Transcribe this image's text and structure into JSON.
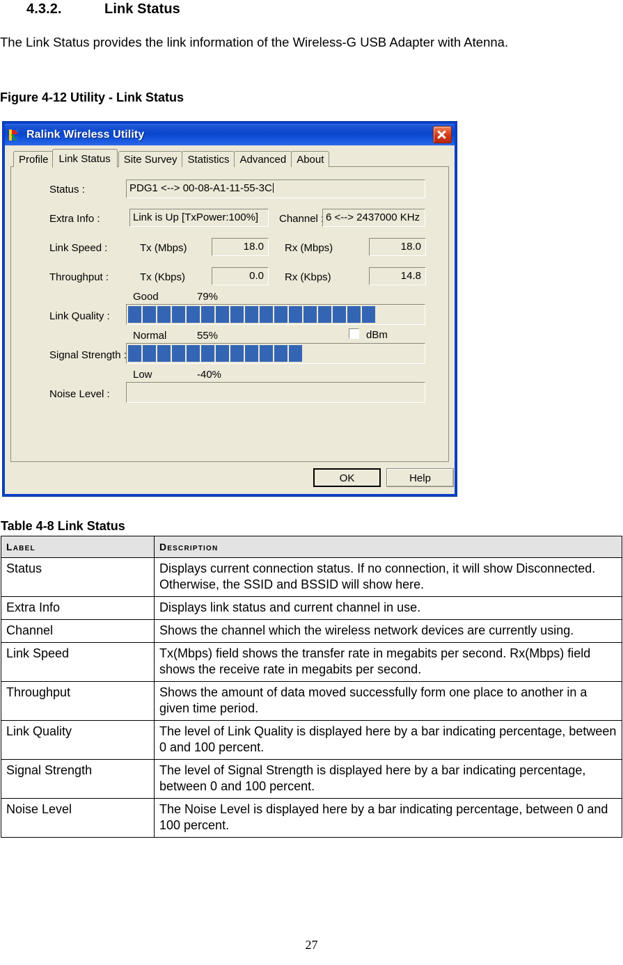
{
  "document": {
    "section_number": "4.3.2.",
    "section_title": "Link Status",
    "intro_paragraph": "The Link Status provides the link information of the Wireless-G USB Adapter with Atenna.",
    "figure_caption": "Figure 4-12 Utility - Link Status",
    "table_caption": "Table 4-8 Link Status",
    "page_number": "27"
  },
  "dialog": {
    "title": "Ralink Wireless Utility",
    "icon": "ralink-logo-icon",
    "close_label": "Close",
    "tabs": [
      {
        "label": "Profile",
        "selected": false
      },
      {
        "label": "Link Status",
        "selected": true
      },
      {
        "label": "Site Survey",
        "selected": false
      },
      {
        "label": "Statistics",
        "selected": false
      },
      {
        "label": "Advanced",
        "selected": false
      },
      {
        "label": "About",
        "selected": false
      }
    ],
    "fields": {
      "status_label": "Status :",
      "status_value": "PDG1 <--> 00-08-A1-11-55-3C",
      "extra_info_label": "Extra Info :",
      "extra_info_value": "Link is Up [TxPower:100%]",
      "channel_label": "Channel :",
      "channel_value": "6 <--> 2437000 KHz",
      "link_speed_label": "Link Speed :",
      "link_speed_tx_label": "Tx (Mbps)",
      "link_speed_tx_value": "18.0",
      "link_speed_rx_label": "Rx (Mbps)",
      "link_speed_rx_value": "18.0",
      "throughput_label": "Throughput :",
      "throughput_tx_label": "Tx (Kbps)",
      "throughput_tx_value": "0.0",
      "throughput_rx_label": "Rx (Kbps)",
      "throughput_rx_value": "14.8",
      "link_quality_label": "Link Quality :",
      "link_quality_rating": "Good",
      "link_quality_percent": "79%",
      "signal_strength_label": "Signal Strength :",
      "signal_strength_rating": "Normal",
      "signal_strength_percent": "55%",
      "noise_level_label": "Noise Level :",
      "noise_level_rating": "Low",
      "noise_level_percent": "-40%",
      "dbm_label": "dBm",
      "dbm_checked": false
    },
    "buttons": {
      "ok_label": "OK",
      "help_label": "Help"
    },
    "colors": {
      "titlebar_blue": "#0a45cd",
      "window_face": "#ece9d8",
      "meter_fill": "#3465b4",
      "close_red": "#cf3516"
    }
  },
  "meters": {
    "link_quality_segments": 17,
    "signal_strength_segments": 12,
    "noise_level_segments": 0,
    "segments_total": 21
  },
  "reference_table": {
    "headers": [
      "Label",
      "Description"
    ],
    "rows": [
      {
        "label": "Status",
        "description": "Displays current connection status. If no connection, it will show Disconnected. Otherwise, the SSID and BSSID will show here."
      },
      {
        "label": "Extra Info",
        "description": "Displays link status and current channel in use."
      },
      {
        "label": "Channel",
        "description": "Shows the channel which the wireless network devices are currently using."
      },
      {
        "label": "Link Speed",
        "description": "Tx(Mbps) field shows the transfer rate in megabits per second. Rx(Mbps) field shows the receive rate in megabits per second."
      },
      {
        "label": "Throughput",
        "description": "Shows the amount of data moved successfully form one place to another in a given time period."
      },
      {
        "label": "Link Quality",
        "description": "The level of Link Quality is displayed here by a bar indicating percentage, between 0 and 100 percent."
      },
      {
        "label": "Signal Strength",
        "description": "The level of Signal Strength is displayed here by a bar indicating percentage, between 0 and 100 percent."
      },
      {
        "label": "Noise Level",
        "description": "The Noise Level is displayed here by a bar indicating percentage, between 0 and 100 percent."
      }
    ]
  }
}
